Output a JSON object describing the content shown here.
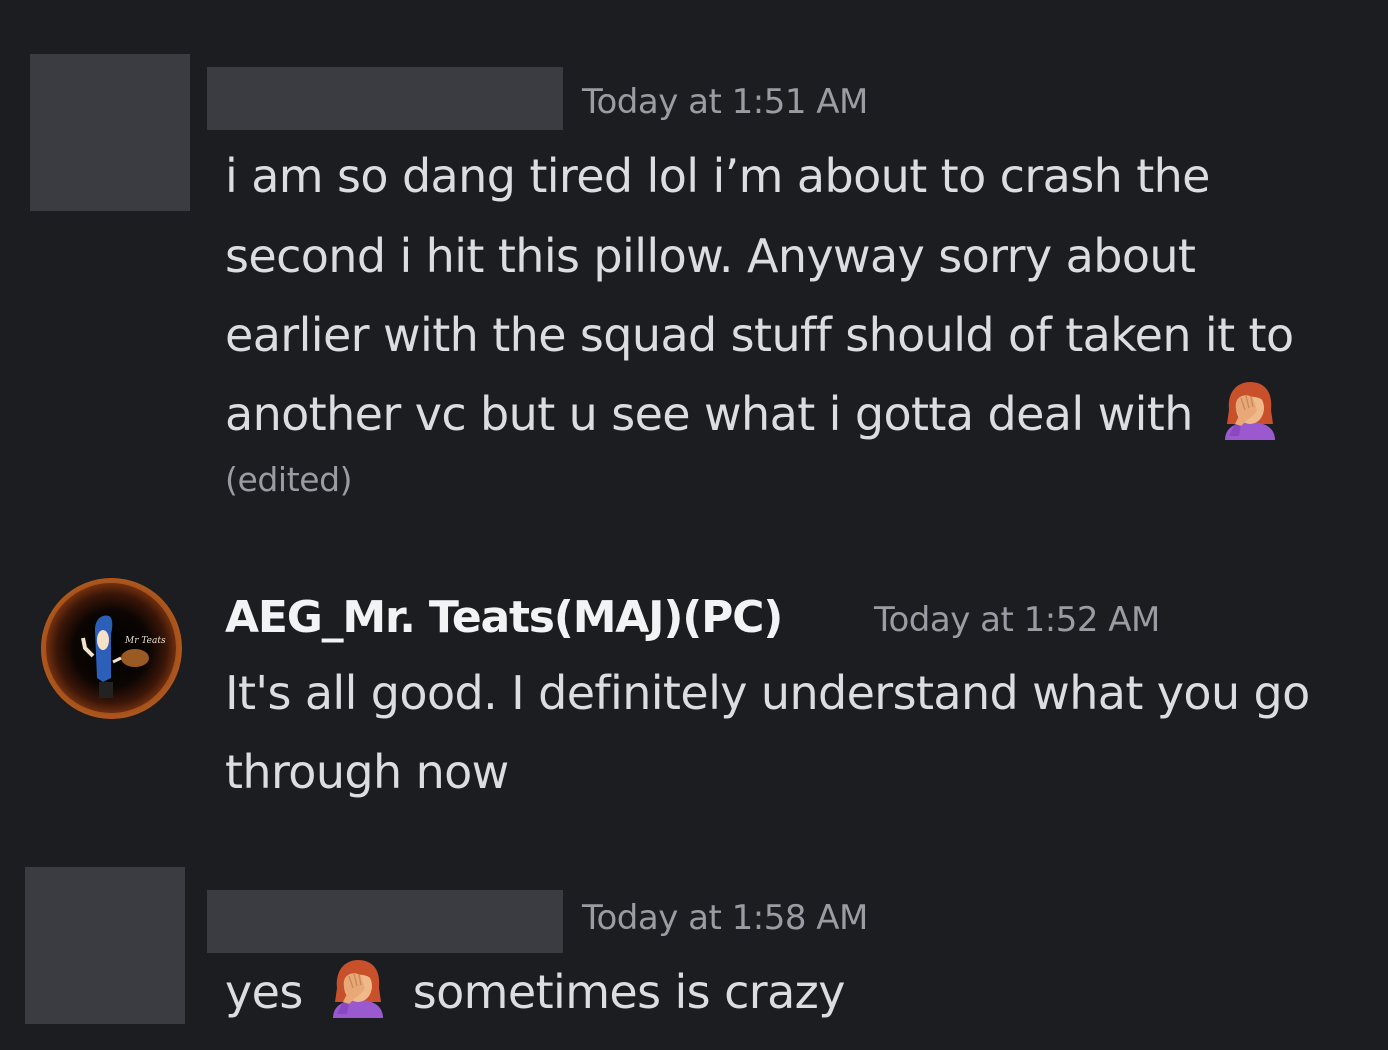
{
  "messages": [
    {
      "timestamp": "Today at 1:51 AM",
      "lines": [
        "i am so dang tired lol i’m about to crash the",
        "second i hit this pillow. Anyway  sorry about",
        "earlier with the squad stuff should of taken it to",
        "another  vc but u see what i gotta deal with"
      ],
      "edited_label": "(edited)",
      "emoji": "woman-facepalming-icon"
    },
    {
      "username": "AEG_Mr. Teats(MAJ)(PC)",
      "timestamp": "Today at 1:52 AM",
      "lines": [
        "It's all good. I definitely understand what you go",
        "through now"
      ],
      "avatar_caption": "Mr Teats"
    },
    {
      "timestamp": "Today at 1:58 AM",
      "text_before_emoji": "yes",
      "text_after_emoji": "sometimes is crazy",
      "emoji": "woman-facepalming-icon"
    }
  ],
  "colors": {
    "background": "#1c1d21",
    "redaction": "#3b3c42",
    "timestamp": "#9a9ca3",
    "text": "#dcdde0",
    "username": "#f2f3f5"
  }
}
